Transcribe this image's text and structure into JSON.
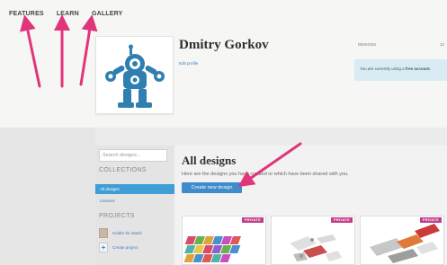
{
  "nav": {
    "items": [
      {
        "label": "FEATURES"
      },
      {
        "label": "LEARN"
      },
      {
        "label": "GALLERY"
      }
    ]
  },
  "profile": {
    "name": "Dmitry Gorkov",
    "edit_link": "Edit profile",
    "designs_label": "DESIGNS",
    "designs_count": "12",
    "account_prefix": "You are currently using a ",
    "account_plan": "free account."
  },
  "sidebar": {
    "search_placeholder": "Search designs...",
    "collections_heading": "COLLECTIONS",
    "collection_items": [
      {
        "label": "All designs"
      },
      {
        "label": "Lessons"
      }
    ],
    "projects_heading": "PROJECTS",
    "project_items": [
      {
        "label": "Holder for watch"
      },
      {
        "label": "Create project"
      }
    ]
  },
  "main": {
    "title": "All designs",
    "subtitle": "Here are the designs you have created or which have been shared with you.",
    "create_button": "Create new design",
    "cards": [
      {
        "badge": "PRIVATE"
      },
      {
        "badge": "PRIVATE"
      },
      {
        "badge": "PRIVATE"
      }
    ]
  },
  "colors": {
    "accent_blue": "#3f9ed6",
    "button_blue": "#3f8ccc",
    "arrow_pink": "#e0357a",
    "private_badge": "#c23d8a",
    "account_box": "#d9ecf4"
  }
}
